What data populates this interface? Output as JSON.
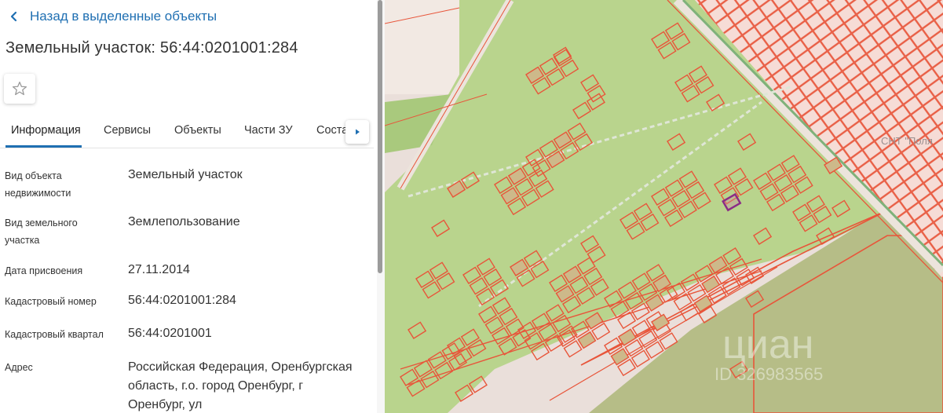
{
  "header": {
    "back_label": "Назад в выделенные объекты",
    "title": "Земельный участок: 56:44:0201001:284"
  },
  "tabs": [
    "Информация",
    "Сервисы",
    "Объекты",
    "Части ЗУ",
    "Соста"
  ],
  "info": {
    "object_type_label": "Вид объекта недвижимости",
    "object_type_value": "Земельный участок",
    "land_type_label": "Вид земельного участка",
    "land_type_value": "Землепользование",
    "assigned_date_label": "Дата присвоения",
    "assigned_date_value": "27.11.2014",
    "cadastral_number_label": "Кадастровый номер",
    "cadastral_number_value": "56:44:0201001:284",
    "cadastral_block_label": "Кадастровый квартал",
    "cadastral_block_value": "56:44:0201001",
    "address_label": "Адрес",
    "address_value": "Российская Федерация, Оренбургская область, г.о. город Оренбург, г Оренбург, ул"
  },
  "map": {
    "area_label": "СНТ \"Поля",
    "watermark_brand": "циан",
    "watermark_id": "ID 326983565"
  },
  "icons": [
    "back-arrow-icon",
    "star-icon",
    "chevron-right-icon"
  ],
  "colors": {
    "accent": "#1f6fb2",
    "map_green": "#b6d08a",
    "parcel_stroke": "#e8553a",
    "selected_parcel": "#8b2b86"
  }
}
